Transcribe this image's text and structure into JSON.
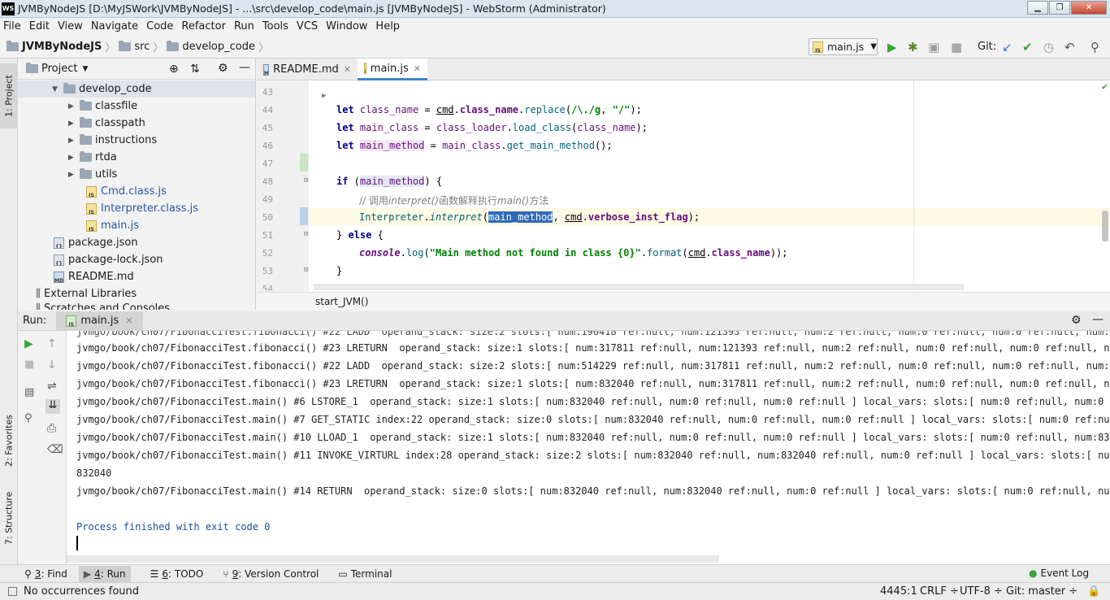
{
  "window": {
    "title": "JVMByNodeJS [D:\\MyJSWork\\JVMByNodeJS] - ...\\src\\develop_code\\main.js [JVMByNodeJS] - WebStorm (Administrator)",
    "app_icon": "WS"
  },
  "menu": [
    "File",
    "Edit",
    "View",
    "Navigate",
    "Code",
    "Refactor",
    "Tools",
    "VCS",
    "Window",
    "Help",
    "Run"
  ],
  "breadcrumb": [
    "JVMByNodeJS",
    "src",
    "develop_code"
  ],
  "toolbar": {
    "run_config": "main.js",
    "git_label": "Git:"
  },
  "project": {
    "title": "Project",
    "items": [
      {
        "label": "develop_code"
      },
      {
        "label": "classfile"
      },
      {
        "label": "classpath"
      },
      {
        "label": "instructions"
      },
      {
        "label": "rtda"
      },
      {
        "label": "utils"
      },
      {
        "label": "Cmd.class.js"
      },
      {
        "label": "Interpreter.class.js"
      },
      {
        "label": "main.js"
      },
      {
        "label": "package.json"
      },
      {
        "label": "package-lock.json"
      },
      {
        "label": "README.md"
      },
      {
        "label": "External Libraries"
      },
      {
        "label": "Scratches and Consoles"
      }
    ]
  },
  "left_tool_tabs": [
    "1: Project",
    "2: Favorites",
    "7: Structure"
  ],
  "editor_tabs": [
    {
      "label": "README.md"
    },
    {
      "label": "main.js"
    }
  ],
  "gutter_lines": [
    "43",
    "44",
    "45",
    "46",
    "47",
    "48",
    "49",
    "50",
    "51",
    "52",
    "53",
    "54"
  ],
  "code_breadcrumb": "start_JVM()",
  "run": {
    "label": "Run:",
    "tab": "main.js",
    "lines": [
      "jvmgo/book/ch07/FibonacciTest.fibonacci() #23 LRETURN  operand_stack: size:1 slots:[ num:317811 ref:null, num:121393 ref:null, num:2 ref:null, num:0 ref:null, num:0 ref:null, num:0 r",
      "jvmgo/book/ch07/FibonacciTest.fibonacci() #22 LADD  operand_stack: size:2 slots:[ num:514229 ref:null, num:317811 ref:null, num:2 ref:null, num:0 ref:null, num:0 ref:null, num:0 r",
      "jvmgo/book/ch07/FibonacciTest.fibonacci() #23 LRETURN  operand_stack: size:1 slots:[ num:832040 ref:null, num:317811 ref:null, num:2 ref:null, num:0 ref:null, num:0 ref:null, num:0 r",
      "jvmgo/book/ch07/FibonacciTest.main() #6 LSTORE_1  operand_stack: size:1 slots:[ num:832040 ref:null, num:0 ref:null, num:0 ref:null ] local_vars: slots:[ num:0 ref:null, num:0 ref:nu",
      "jvmgo/book/ch07/FibonacciTest.main() #7 GET_STATIC index:22 operand_stack: size:0 slots:[ num:832040 ref:null, num:0 ref:null, num:0 ref:null ] local_vars: slots:[ num:0 ref:null, nu",
      "jvmgo/book/ch07/FibonacciTest.main() #10 LLOAD_1  operand_stack: size:1 slots:[ num:832040 ref:null, num:0 ref:null, num:0 ref:null ] local_vars: slots:[ num:0 ref:null, num:832040 r",
      "jvmgo/book/ch07/FibonacciTest.main() #11 INVOKE_VIRTURL index:28 operand_stack: size:2 slots:[ num:832040 ref:null, num:832040 ref:null, num:0 ref:null ] local_vars: slots:[ num:0 re",
      "832040",
      "jvmgo/book/ch07/FibonacciTest.main() #14 RETURN  operand_stack: size:0 slots:[ num:832040 ref:null, num:832040 ref:null, num:0 ref:null ] local_vars: slots:[ num:0 ref:null, num:8320",
      "",
      "Process finished with exit code 0"
    ]
  },
  "bottom_tabs": [
    {
      "key": "3",
      "label": ": Find"
    },
    {
      "key": "4",
      "label": ": Run"
    },
    {
      "key": "6",
      "label": ": TODO"
    },
    {
      "key": "9",
      "label": ": Version Control"
    },
    {
      "key": "",
      "label": "Terminal"
    }
  ],
  "event_log": "Event Log",
  "status": {
    "message": "No occurrences found",
    "position": "4445:1",
    "line_sep": "CRLF ÷",
    "encoding": "UTF-8 ÷",
    "git": "Git: master ÷"
  }
}
